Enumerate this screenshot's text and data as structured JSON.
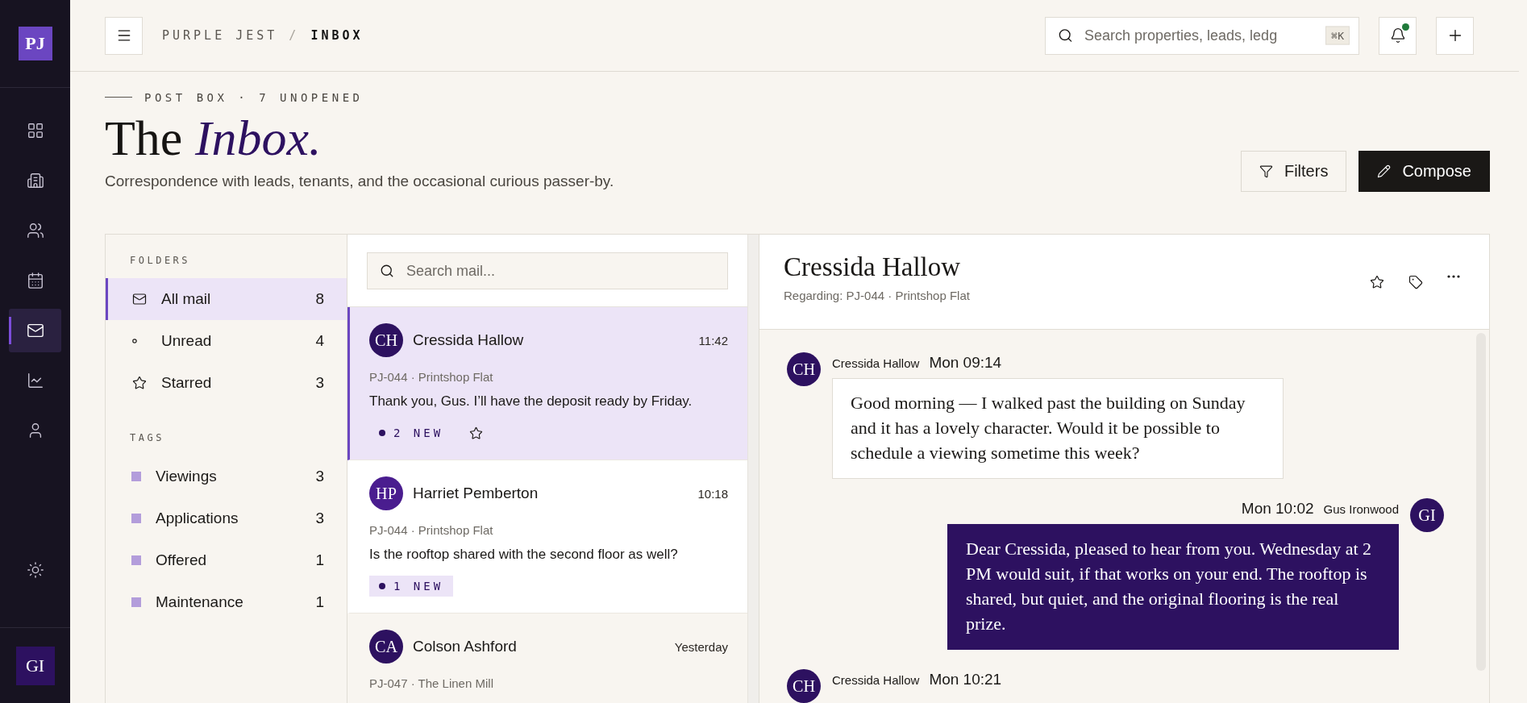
{
  "app": {
    "logo": "PJ",
    "user_initials": "GI"
  },
  "nav": [
    {
      "kind": "dashboard",
      "selected": false
    },
    {
      "kind": "building",
      "selected": false
    },
    {
      "kind": "people",
      "selected": false
    },
    {
      "kind": "calendar",
      "selected": false
    },
    {
      "kind": "mail",
      "selected": true
    },
    {
      "kind": "chart",
      "selected": false
    },
    {
      "kind": "person",
      "selected": false
    }
  ],
  "topbar": {
    "breadcrumb": [
      "PURPLE JEST",
      "INBOX"
    ],
    "separator": "/",
    "search": {
      "placeholder": "Search properties, leads, ledg",
      "shortcut": "⌘K"
    },
    "notifications_unread": true
  },
  "header": {
    "eyebrow": "POST BOX · 7 UNOPENED",
    "title": "The",
    "title_accent": "Inbox.",
    "subtitle": "Correspondence with leads, tenants, and the occasional curious passer-by.",
    "actions": [
      {
        "kind": "filter",
        "label": "Filters"
      },
      {
        "kind": "compose",
        "label": "Compose"
      }
    ]
  },
  "folders": {
    "heading": "FOLDERS",
    "items": [
      {
        "kind": "mail",
        "label": "All mail",
        "count": "8",
        "selected": true
      },
      {
        "kind": "dot",
        "label": "Unread",
        "count": "4",
        "selected": false
      },
      {
        "kind": "star",
        "label": "Starred",
        "count": "3",
        "selected": false
      }
    ]
  },
  "tags": {
    "heading": "TAGS",
    "items": [
      {
        "label": "Viewings",
        "count": "3"
      },
      {
        "label": "Applications",
        "count": "3"
      },
      {
        "label": "Offered",
        "count": "1"
      },
      {
        "label": "Maintenance",
        "count": "1"
      }
    ]
  },
  "mail_search": {
    "placeholder": "Search mail..."
  },
  "threads": [
    {
      "initials": "CH",
      "color": "#2d1160",
      "name": "Cressida Hallow",
      "time": "11:42",
      "property": "PJ-044 · Printshop Flat",
      "preview": "Thank you, Gus. I’ll have the deposit ready by Friday.",
      "badge": "2 NEW",
      "selected": true,
      "read": false
    },
    {
      "initials": "HP",
      "color": "#4a1d8f",
      "name": "Harriet Pemberton",
      "time": "10:18",
      "property": "PJ-044 · Printshop Flat",
      "preview": "Is the rooftop shared with the second floor as well?",
      "badge": "1 NEW",
      "selected": false,
      "read": false
    },
    {
      "initials": "CA",
      "color": "#2d1160",
      "name": "Colson Ashford",
      "time": "Yesterday",
      "property": "PJ-047 · The Linen Mill",
      "selected": false,
      "read": true
    }
  ],
  "conversation": {
    "title": "Cressida Hallow",
    "regarding": "Regarding: PJ-044 · Printshop Flat",
    "messages": [
      {
        "kind": "incoming",
        "initials": "CH",
        "sender": "Cressida Hallow",
        "time": "Mon 09:14",
        "body": "Good morning — I walked past the building on Sunday and it has a lovely character. Would it be possible to schedule a viewing sometime this week?"
      },
      {
        "kind": "outgoing",
        "initials": "GI",
        "sender": "Gus Ironwood",
        "time": "Mon 10:02",
        "body": "Dear Cressida, pleased to hear from you. Wednesday at 2 PM would suit, if that works on your end. The rooftop is shared, but quiet, and the original flooring is the real prize."
      },
      {
        "kind": "incoming",
        "initials": "CH",
        "sender": "Cressida Hallow",
        "time": "Mon 10:21"
      }
    ]
  }
}
